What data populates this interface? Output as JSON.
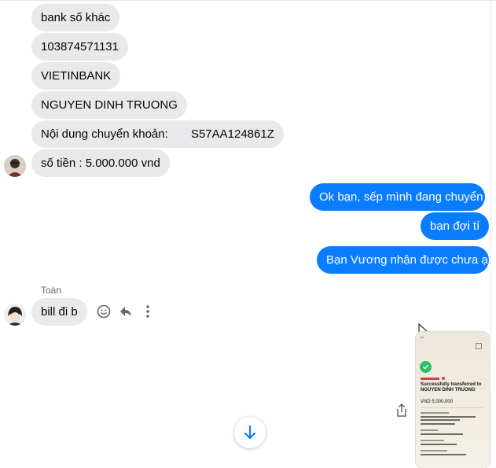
{
  "incoming_messages": [
    "bank số khác",
    "103874571131",
    "VIETINBANK",
    "NGUYEN DINH TRUONG",
    "Nội dung chuyển khoản:       S57AA124861Z",
    "số tiền : 5.000.000 vnd"
  ],
  "outgoing_messages": [
    "Ok bạn, sếp mình đang chuyển",
    "bạn đợi tí",
    "Bạn Vương nhận được chưa ạ"
  ],
  "second_sender": {
    "name": "Toàn",
    "message": "bill đi b"
  },
  "receipt": {
    "heading": "Successfully transferred to NGUYEN DINH TRUONG",
    "amount": "VND 5,000,000"
  },
  "colors": {
    "outgoing": "#0a7cff",
    "incoming": "#e9e9eb",
    "success": "#2dbe60"
  }
}
